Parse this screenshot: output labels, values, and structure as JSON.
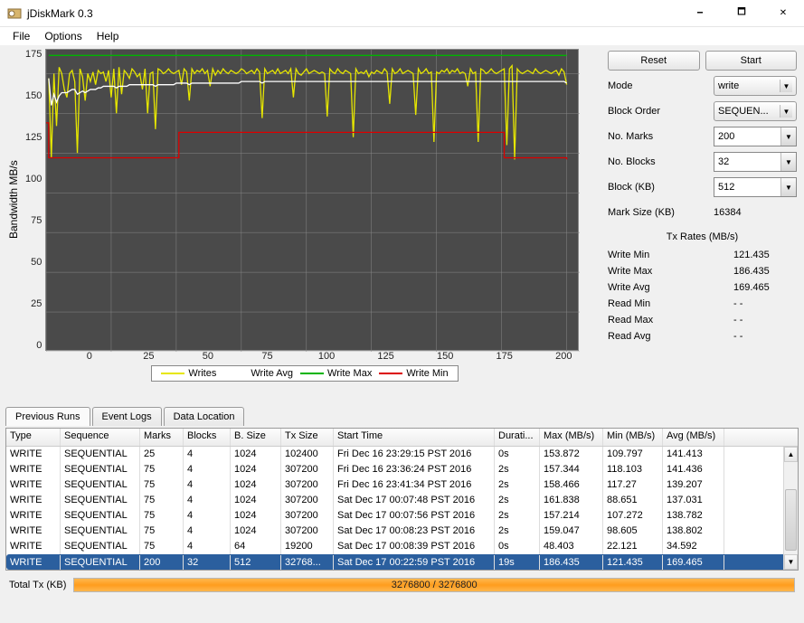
{
  "window": {
    "title": "jDiskMark 0.3"
  },
  "menu": [
    "File",
    "Options",
    "Help"
  ],
  "chart_data": {
    "type": "line",
    "title": "",
    "xlabel": "",
    "ylabel": "Bandwidth MB/s",
    "xlim": [
      0,
      205
    ],
    "ylim": [
      0,
      190
    ],
    "xticks": [
      0,
      25,
      50,
      75,
      100,
      125,
      150,
      175,
      200
    ],
    "yticks": [
      0,
      25,
      50,
      75,
      100,
      125,
      150,
      175
    ],
    "series": [
      {
        "name": "Writes",
        "color": "#e6e600",
        "values": [
          172,
          122,
          175,
          142,
          179,
          175,
          165,
          160,
          175,
          177,
          170,
          125,
          178,
          173,
          158,
          175,
          170,
          176,
          168,
          177,
          175,
          176,
          170,
          177,
          160,
          178,
          150,
          179,
          162,
          177,
          175,
          172,
          178,
          176,
          173,
          175,
          165,
          178,
          150,
          175,
          176,
          140,
          178,
          177,
          175,
          176,
          178,
          176,
          175,
          176,
          177,
          168,
          178,
          176,
          158,
          178,
          175,
          177,
          176,
          178,
          175,
          177,
          167,
          178,
          174,
          177,
          175,
          178,
          176,
          175,
          177,
          176,
          175,
          176,
          178,
          177,
          175,
          176,
          177,
          175,
          178,
          176,
          147,
          178,
          175,
          176,
          177,
          175,
          178,
          175,
          176,
          177,
          175,
          178,
          160,
          178,
          175,
          174,
          176,
          178,
          175,
          176,
          177,
          176,
          175,
          176,
          175,
          148,
          178,
          176,
          175,
          178,
          176,
          175,
          177,
          176,
          175,
          135,
          178,
          175,
          176,
          175,
          177,
          173,
          176,
          175,
          177,
          176,
          175,
          178,
          176,
          156,
          178,
          175,
          176,
          178,
          175,
          176,
          177,
          176,
          175,
          149,
          178,
          175,
          176,
          178,
          175,
          176,
          132,
          176,
          175,
          177,
          176,
          178,
          175,
          177,
          176,
          178,
          175,
          176,
          175,
          167,
          178,
          175,
          176,
          132,
          178,
          177,
          175,
          176,
          178,
          176,
          175,
          176,
          177,
          178,
          130,
          178,
          180,
          121,
          178,
          176,
          175,
          176,
          177,
          176,
          175,
          178,
          176,
          175,
          176,
          177,
          176,
          175,
          176,
          177,
          174,
          178,
          176,
          168
        ]
      },
      {
        "name": "Write Avg",
        "color": "#ffffff",
        "values": [
          172,
          155,
          162,
          157,
          161,
          163,
          163,
          163,
          164,
          165,
          165,
          162,
          163,
          164,
          163,
          164,
          165,
          165,
          165,
          166,
          166,
          167,
          167,
          167,
          167,
          167,
          166,
          167,
          167,
          167,
          167,
          168,
          168,
          168,
          168,
          168,
          168,
          168,
          168,
          168,
          168,
          167,
          168,
          168,
          168,
          168,
          168,
          168,
          168,
          169,
          169,
          169,
          169,
          169,
          168,
          169,
          169,
          169,
          169,
          169,
          169,
          169,
          169,
          169,
          169,
          169,
          169,
          169,
          169,
          169,
          169,
          169,
          169,
          169,
          170,
          170,
          170,
          170,
          170,
          170,
          170,
          170,
          169,
          170,
          170,
          170,
          170,
          170,
          170,
          170,
          170,
          170,
          170,
          170,
          170,
          170,
          170,
          170,
          170,
          170,
          170,
          170,
          170,
          170,
          170,
          170,
          170,
          170,
          170,
          170,
          170,
          170,
          170,
          170,
          170,
          170,
          170,
          170,
          170,
          170,
          170,
          170,
          170,
          170,
          170,
          170,
          170,
          170,
          170,
          170,
          170,
          170,
          170,
          170,
          170,
          170,
          170,
          170,
          170,
          170,
          170,
          170,
          170,
          170,
          170,
          170,
          170,
          170,
          170,
          170,
          170,
          170,
          170,
          170,
          170,
          170,
          170,
          170,
          170,
          170,
          170,
          170,
          170,
          170,
          170,
          170,
          170,
          170,
          170,
          170,
          170,
          170,
          170,
          170,
          170,
          170,
          170,
          170,
          170,
          170,
          170,
          170,
          170,
          170,
          170,
          170,
          170,
          170,
          170,
          170,
          170,
          170,
          170,
          170,
          170,
          170,
          170,
          170,
          170,
          169
        ]
      },
      {
        "name": "Write Max",
        "color": "#00b400",
        "constant": 186.4
      },
      {
        "name": "Write Min",
        "color": "#dc0000",
        "steps": [
          [
            0,
            144
          ],
          [
            1,
            122
          ],
          [
            51,
            122
          ],
          [
            51,
            138
          ],
          [
            80,
            138
          ],
          [
            81,
            138
          ],
          [
            132,
            138
          ],
          [
            133,
            138
          ],
          [
            175,
            138
          ],
          [
            176,
            122
          ],
          [
            200,
            121
          ]
        ]
      }
    ]
  },
  "legend": [
    {
      "label": "Writes",
      "color": "#e6e600"
    },
    {
      "label": "Write Avg",
      "color": "#ffffff"
    },
    {
      "label": "Write Max",
      "color": "#00b400"
    },
    {
      "label": "Write Min",
      "color": "#dc0000"
    }
  ],
  "buttons": {
    "reset": "Reset",
    "start": "Start"
  },
  "settings": {
    "mode": {
      "label": "Mode",
      "value": "write"
    },
    "blockOrder": {
      "label": "Block Order",
      "value": "SEQUEN..."
    },
    "noMarks": {
      "label": "No. Marks",
      "value": "200"
    },
    "noBlocks": {
      "label": "No. Blocks",
      "value": "32"
    },
    "blockKB": {
      "label": "Block (KB)",
      "value": "512"
    },
    "markSize": {
      "label": "Mark Size (KB)",
      "value": "16384"
    }
  },
  "txRatesHeading": "Tx Rates (MB/s)",
  "stats": [
    {
      "label": "Write Min",
      "value": "121.435"
    },
    {
      "label": "Write Max",
      "value": "186.435"
    },
    {
      "label": "Write Avg",
      "value": "169.465"
    },
    {
      "label": "Read Min",
      "value": "- -"
    },
    {
      "label": "Read Max",
      "value": "- -"
    },
    {
      "label": "Read Avg",
      "value": "- -"
    }
  ],
  "tabs": [
    "Previous Runs",
    "Event Logs",
    "Data Location"
  ],
  "table": {
    "columns": [
      "Type",
      "Sequence",
      "Marks",
      "Blocks",
      "B. Size",
      "Tx Size",
      "Start Time",
      "Durati...",
      "Max (MB/s)",
      "Min (MB/s)",
      "Avg (MB/s)"
    ],
    "rows": [
      [
        "WRITE",
        "SEQUENTIAL",
        "25",
        "4",
        "1024",
        "102400",
        "Fri Dec 16 23:29:15 PST 2016",
        "0s",
        "153.872",
        "109.797",
        "141.413"
      ],
      [
        "WRITE",
        "SEQUENTIAL",
        "75",
        "4",
        "1024",
        "307200",
        "Fri Dec 16 23:36:24 PST 2016",
        "2s",
        "157.344",
        "118.103",
        "141.436"
      ],
      [
        "WRITE",
        "SEQUENTIAL",
        "75",
        "4",
        "1024",
        "307200",
        "Fri Dec 16 23:41:34 PST 2016",
        "2s",
        "158.466",
        "117.27",
        "139.207"
      ],
      [
        "WRITE",
        "SEQUENTIAL",
        "75",
        "4",
        "1024",
        "307200",
        "Sat Dec 17 00:07:48 PST 2016",
        "2s",
        "161.838",
        "88.651",
        "137.031"
      ],
      [
        "WRITE",
        "SEQUENTIAL",
        "75",
        "4",
        "1024",
        "307200",
        "Sat Dec 17 00:07:56 PST 2016",
        "2s",
        "157.214",
        "107.272",
        "138.782"
      ],
      [
        "WRITE",
        "SEQUENTIAL",
        "75",
        "4",
        "1024",
        "307200",
        "Sat Dec 17 00:08:23 PST 2016",
        "2s",
        "159.047",
        "98.605",
        "138.802"
      ],
      [
        "WRITE",
        "SEQUENTIAL",
        "75",
        "4",
        "64",
        "19200",
        "Sat Dec 17 00:08:39 PST 2016",
        "0s",
        "48.403",
        "22.121",
        "34.592"
      ],
      [
        "WRITE",
        "SEQUENTIAL",
        "200",
        "32",
        "512",
        "32768...",
        "Sat Dec 17 00:22:59 PST 2016",
        "19s",
        "186.435",
        "121.435",
        "169.465"
      ]
    ],
    "selectedIndex": 7
  },
  "footer": {
    "label": "Total Tx (KB)",
    "progressText": "3276800 / 3276800"
  }
}
